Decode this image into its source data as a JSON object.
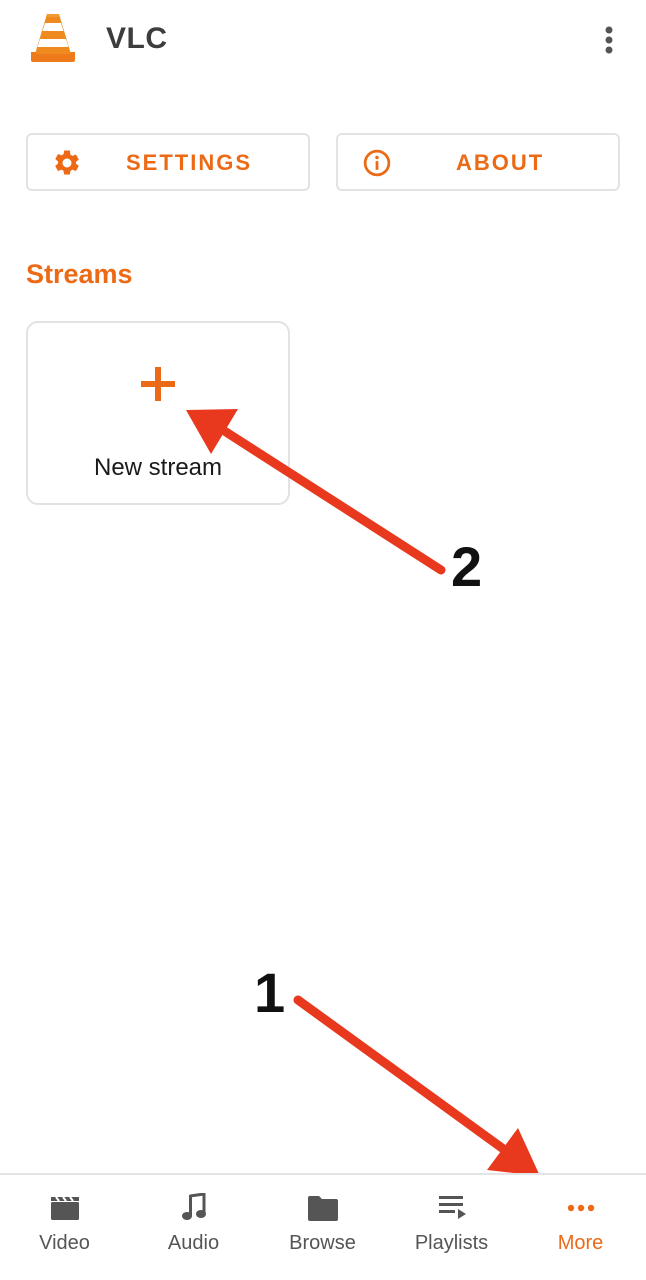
{
  "header": {
    "title": "VLC",
    "logo_icon": "vlc-cone-icon",
    "overflow_icon": "more-vert-icon"
  },
  "actions": {
    "settings_label": "SETTINGS",
    "settings_icon": "gear-icon",
    "about_label": "ABOUT",
    "about_icon": "info-icon"
  },
  "streams": {
    "section_title": "Streams",
    "new_stream_label": "New stream",
    "new_stream_icon": "plus-icon"
  },
  "annotations": {
    "step_1": "1",
    "step_2": "2",
    "arrow_color": "#e8391f"
  },
  "bottom_nav": {
    "items": [
      {
        "label": "Video",
        "icon": "video-clapper-icon",
        "active": false
      },
      {
        "label": "Audio",
        "icon": "music-note-icon",
        "active": false
      },
      {
        "label": "Browse",
        "icon": "folder-icon",
        "active": false
      },
      {
        "label": "Playlists",
        "icon": "playlist-icon",
        "active": false
      },
      {
        "label": "More",
        "icon": "more-horiz-icon",
        "active": true
      }
    ]
  },
  "colors": {
    "accent": "#ec6a16",
    "text_primary": "#1a1a1a",
    "text_secondary": "#555555",
    "border": "#e3e3e3"
  }
}
